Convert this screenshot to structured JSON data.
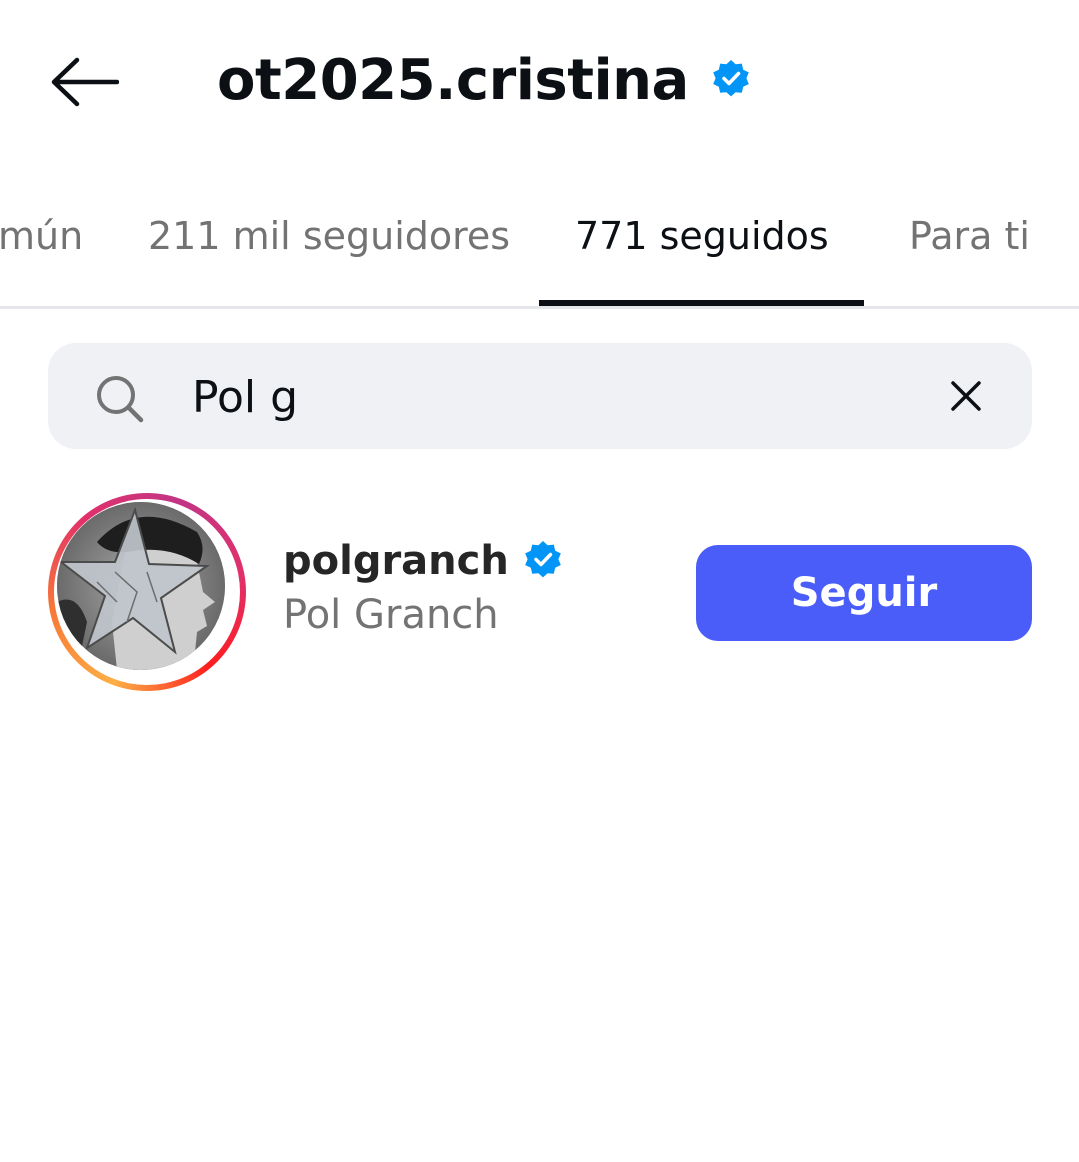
{
  "header": {
    "username": "ot2025.cristina",
    "back_icon": "arrow-left-icon",
    "verified_icon": "verified-badge-icon",
    "verified_color": "#0095f6"
  },
  "tabs": [
    {
      "label": "mún",
      "active": false
    },
    {
      "label": "211 mil seguidores",
      "active": false
    },
    {
      "label": "771 seguidos",
      "active": true
    },
    {
      "label": "Para ti",
      "active": false
    }
  ],
  "search": {
    "value": "Pol g",
    "icon": "search-icon",
    "clear_icon": "close-icon"
  },
  "results": [
    {
      "username": "polgranch",
      "full_name": "Pol Granch",
      "verified": true,
      "button_label": "Seguir",
      "button_color": "#4a5df9"
    }
  ]
}
